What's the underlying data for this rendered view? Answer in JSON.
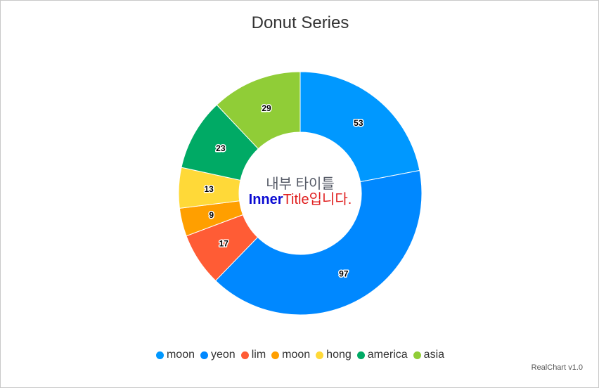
{
  "chart_data": {
    "type": "pie",
    "variant": "donut",
    "title": "Donut Series",
    "inner_title": {
      "line1": "내부 타이틀",
      "line2_bold": "Inner",
      "line2_rest": "Title입니다."
    },
    "categories": [
      "moon",
      "yeon",
      "lim",
      "moon",
      "hong",
      "america",
      "asia"
    ],
    "values": [
      53,
      97,
      17,
      9,
      13,
      23,
      29
    ],
    "colors": [
      "#0098ff",
      "#0088ff",
      "#ff5c35",
      "#ff9f00",
      "#ffd938",
      "#00aa65",
      "#90cd37"
    ],
    "legend_position": "bottom"
  },
  "credits": "RealChart v1.0"
}
